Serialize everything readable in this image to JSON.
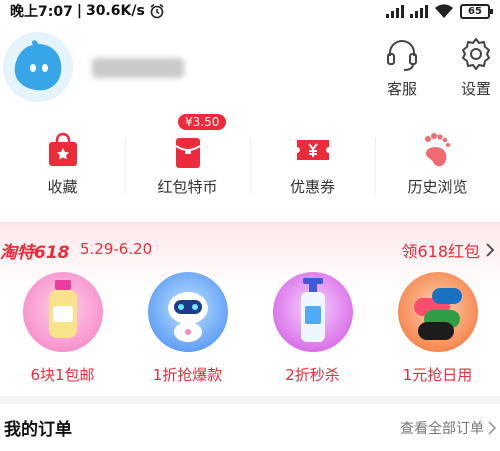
{
  "status_bar": {
    "time": "晚上7:07",
    "separator": "|",
    "speed": "30.6K/s",
    "battery": "65"
  },
  "header": {
    "service_label": "客服",
    "settings_label": "设置"
  },
  "shortcuts": [
    {
      "label": "收藏",
      "icon": "favorite-bag-icon"
    },
    {
      "label": "红包特币",
      "icon": "red-envelope-icon",
      "badge": "¥3.50"
    },
    {
      "label": "优惠券",
      "icon": "coupon-icon"
    },
    {
      "label": "历史浏览",
      "icon": "footprint-icon"
    }
  ],
  "promo": {
    "brand": "淘特618",
    "dates": "5.29-6.20",
    "link_label": "领618红包",
    "items": [
      {
        "label": "6块1包邮",
        "icon": "lotion-bottle-icon"
      },
      {
        "label": "1折抢爆款",
        "icon": "robot-icon"
      },
      {
        "label": "2折秒杀",
        "icon": "hand-wash-icon"
      },
      {
        "label": "1元抢日用",
        "icon": "trash-bag-roll-icon"
      }
    ]
  },
  "orders": {
    "title": "我的订单",
    "view_all": "查看全部订单"
  },
  "colors": {
    "accent": "#ee2b3a",
    "avatar_blue": "#37a6e8",
    "muted": "#777777"
  }
}
